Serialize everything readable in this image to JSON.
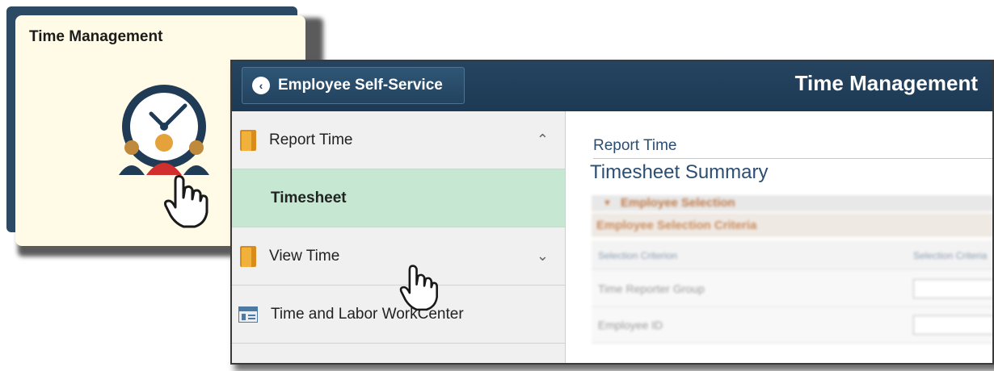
{
  "tile": {
    "title": "Time Management",
    "icon": "clock-people-icon"
  },
  "banner": {
    "back_label": "Employee Self-Service",
    "title": "Time Management"
  },
  "nav": {
    "items": [
      {
        "label": "Report Time",
        "icon": "folder-icon",
        "state": "expanded",
        "caret": "^"
      },
      {
        "label": "Timesheet",
        "icon": "",
        "state": "selected"
      },
      {
        "label": "View Time",
        "icon": "folder-icon",
        "state": "collapsed",
        "caret": "v"
      },
      {
        "label": "Time and Labor WorkCenter",
        "icon": "workcenter-icon"
      }
    ]
  },
  "content": {
    "breadcrumb": "Report Time",
    "page_title": "Timesheet Summary",
    "section_header": "Employee Selection",
    "criteria_header": "Employee Selection Criteria",
    "columns": [
      "Selection Criterion",
      "Selection Criteria"
    ],
    "rows": [
      {
        "label": "Time Reporter Group"
      },
      {
        "label": "Employee ID"
      }
    ]
  },
  "colors": {
    "banner": "#1d3a55",
    "tile_bg": "#fffbe6",
    "selected_nav": "#c6e8d3",
    "link_text": "#2b4e72"
  }
}
